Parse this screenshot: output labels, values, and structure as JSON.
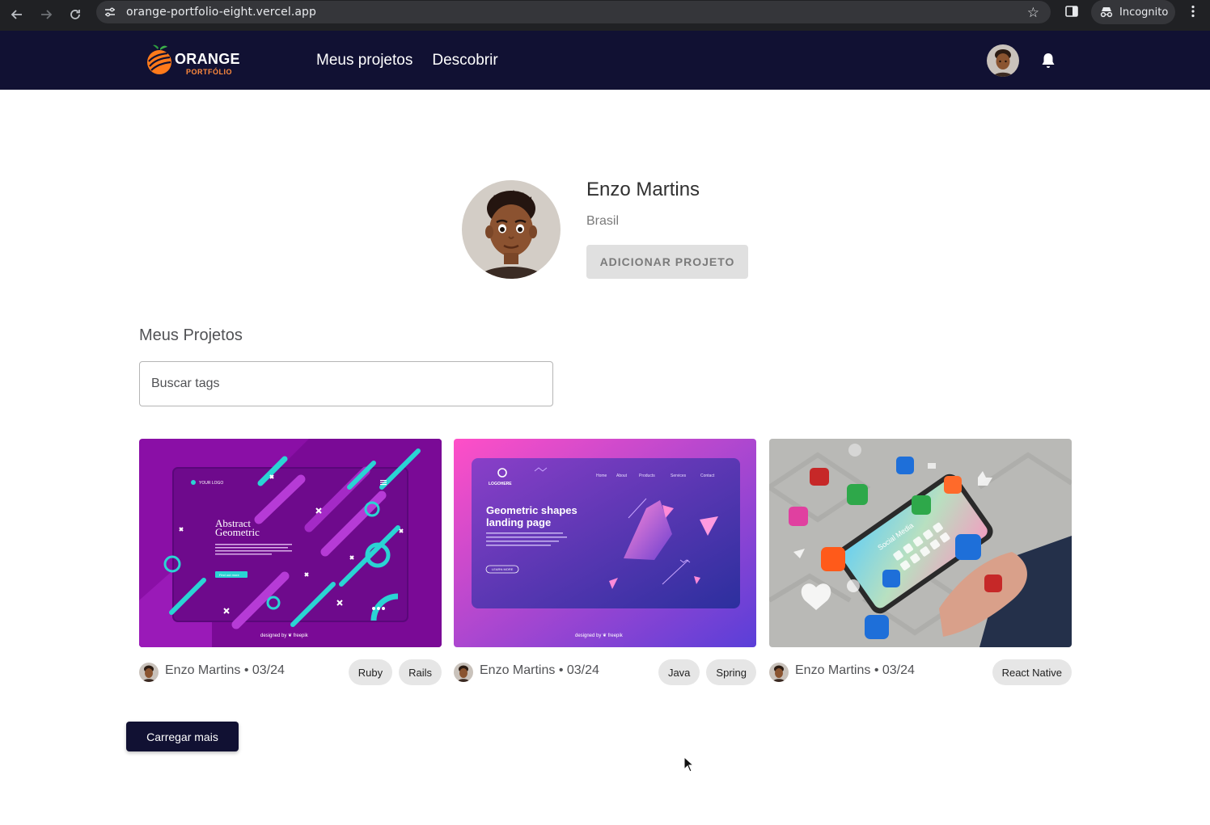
{
  "browser": {
    "url": "orange-portfolio-eight.vercel.app",
    "incognito_label": "Incognito"
  },
  "header": {
    "logo_word": "ORANGE",
    "logo_sub": "PORTFÓLIO",
    "nav": [
      "Meus projetos",
      "Descobrir"
    ]
  },
  "profile": {
    "name": "Enzo Martins",
    "country": "Brasil",
    "add_button": "ADICIONAR PROJETO"
  },
  "projects_section": {
    "title": "Meus Projetos",
    "search_placeholder": "Buscar tags"
  },
  "cards": [
    {
      "author_date": "Enzo Martins • 03/24",
      "tags": [
        "Ruby",
        "Rails"
      ],
      "image": {
        "heading_line1": "Abstract",
        "heading_line2": "Geometric",
        "logo": "YOUR LOGO",
        "button": "Find out more",
        "credit": "designed by ❦ freepik"
      }
    },
    {
      "author_date": "Enzo Martins • 03/24",
      "tags": [
        "Java",
        "Spring"
      ],
      "image": {
        "logo": "LOGOHERE",
        "nav": [
          "Home",
          "About",
          "Products",
          "Services",
          "Contact"
        ],
        "heading_line1": "Geometric shapes",
        "heading_line2": "landing page",
        "button": "LEARN MORE",
        "credit": "designed by ❦ freepik"
      }
    },
    {
      "author_date": "Enzo Martins • 03/24",
      "tags": [
        "React Native"
      ],
      "image": {
        "screen_text": "Social Media"
      }
    }
  ],
  "load_more": "Carregar mais",
  "colors": {
    "header_bg": "#111133",
    "accent_orange": "#ff6b00",
    "button_disabled": "#e0e0e0"
  }
}
